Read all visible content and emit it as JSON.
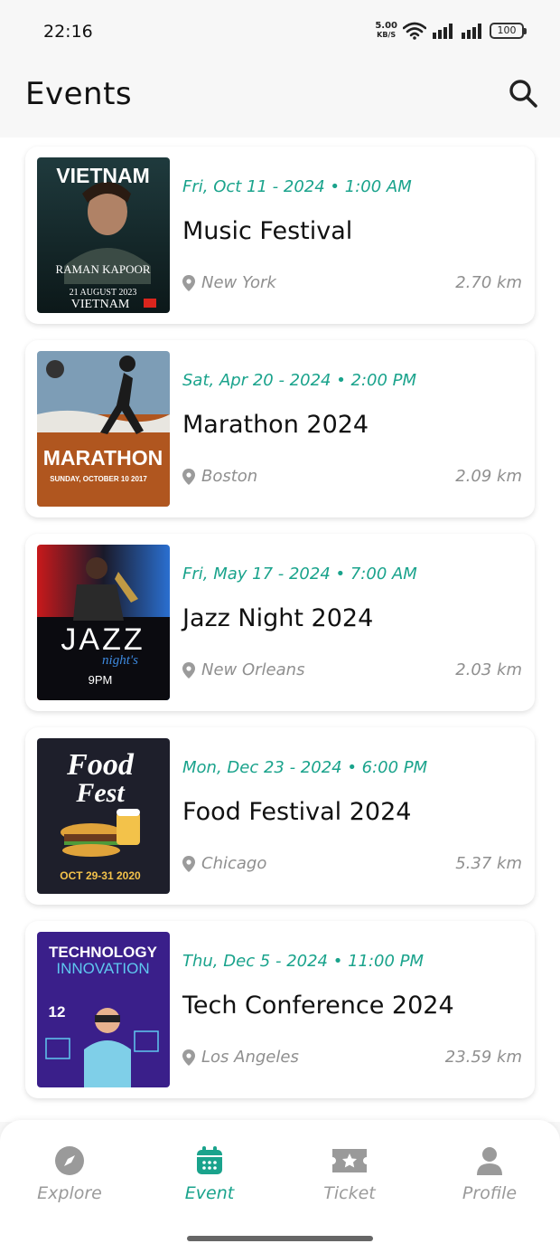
{
  "status_bar": {
    "time": "22:16",
    "net_speed_value": "5.00",
    "net_speed_unit": "KB/S",
    "battery": "100"
  },
  "header": {
    "title": "Events",
    "search_icon": "search-icon"
  },
  "events": [
    {
      "date": "Fri, Oct 11 - 2024 • 1:00 AM",
      "title": "Music Festival",
      "location": "New York",
      "distance": "2.70 km",
      "poster": {
        "line1": "VIETNAM",
        "line2": "RAMAN KAPOOR",
        "line3": "21 AUGUST 2023",
        "line4": "VIETNAM"
      }
    },
    {
      "date": "Sat, Apr 20 - 2024 • 2:00 PM",
      "title": "Marathon 2024",
      "location": "Boston",
      "distance": "2.09 km",
      "poster": {
        "line1": "MARATHON",
        "line2": "SUNDAY, OCTOBER 10 2017"
      }
    },
    {
      "date": "Fri, May 17 - 2024 • 7:00 AM",
      "title": "Jazz Night 2024",
      "location": "New Orleans",
      "distance": "2.03 km",
      "poster": {
        "line1": "JAZZ",
        "line2": "night's",
        "line3": "9PM"
      }
    },
    {
      "date": "Mon, Dec 23 - 2024 • 6:00 PM",
      "title": "Food Festival 2024",
      "location": "Chicago",
      "distance": "5.37 km",
      "poster": {
        "line1": "Food",
        "line2": "Fest",
        "line3": "OCT 29-31 2020"
      }
    },
    {
      "date": "Thu, Dec 5 - 2024 • 11:00 PM",
      "title": "Tech Conference 2024",
      "location": "Los Angeles",
      "distance": "23.59 km",
      "poster": {
        "line1": "TECHNOLOGY",
        "line2": "INNOVATION",
        "line3": "12"
      }
    }
  ],
  "bottom_nav": [
    {
      "label": "Explore",
      "icon": "compass-icon",
      "active": false
    },
    {
      "label": "Event",
      "icon": "calendar-icon",
      "active": true
    },
    {
      "label": "Ticket",
      "icon": "ticket-icon",
      "active": false
    },
    {
      "label": "Profile",
      "icon": "person-icon",
      "active": false
    }
  ],
  "colors": {
    "accent": "#1aa38c",
    "muted": "#8f8f8f",
    "inactive_nav": "#9a9a9a"
  }
}
